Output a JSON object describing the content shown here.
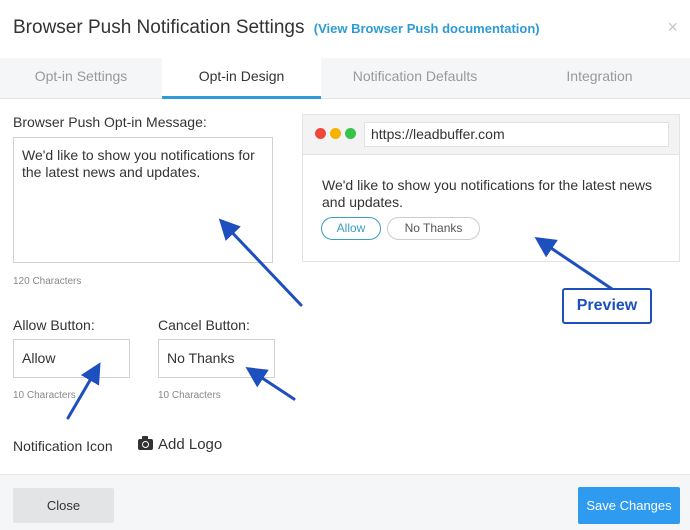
{
  "modal": {
    "title": "Browser Push Notification Settings",
    "doc_link": "(View Browser Push documentation)",
    "close_symbol": "×"
  },
  "tabs": [
    {
      "label": "Opt-in Settings",
      "active": false
    },
    {
      "label": "Opt-in Design",
      "active": true
    },
    {
      "label": "Notification Defaults",
      "active": false
    },
    {
      "label": "Integration",
      "active": false
    }
  ],
  "form": {
    "message_label": "Browser Push Opt-in Message:",
    "message_value": "We'd like to show you notifications for the latest news and updates.",
    "message_hint": "120 Characters",
    "allow_label": "Allow Button:",
    "allow_value": "Allow",
    "allow_hint": "10 Characters",
    "cancel_label": "Cancel Button:",
    "cancel_value": "No Thanks",
    "cancel_hint": "10 Characters",
    "icon_label": "Notification Icon",
    "add_logo": "Add Logo",
    "add_logo_icon": "camera-icon"
  },
  "preview": {
    "url": "https://leadbuffer.com",
    "message": "We'd like to show you notifications for the latest news and updates.",
    "allow_button": "Allow",
    "cancel_button": "No Thanks",
    "window_dot_colors": [
      "#f0473d",
      "#f5b300",
      "#37c24a"
    ]
  },
  "annotation": {
    "callout": "Preview",
    "arrow_color": "#1d4fbf"
  },
  "footer": {
    "close_label": "Close",
    "save_label": "Save Changes"
  },
  "colors": {
    "accent": "#2e9bd6",
    "save_button": "#2e9bf0"
  }
}
